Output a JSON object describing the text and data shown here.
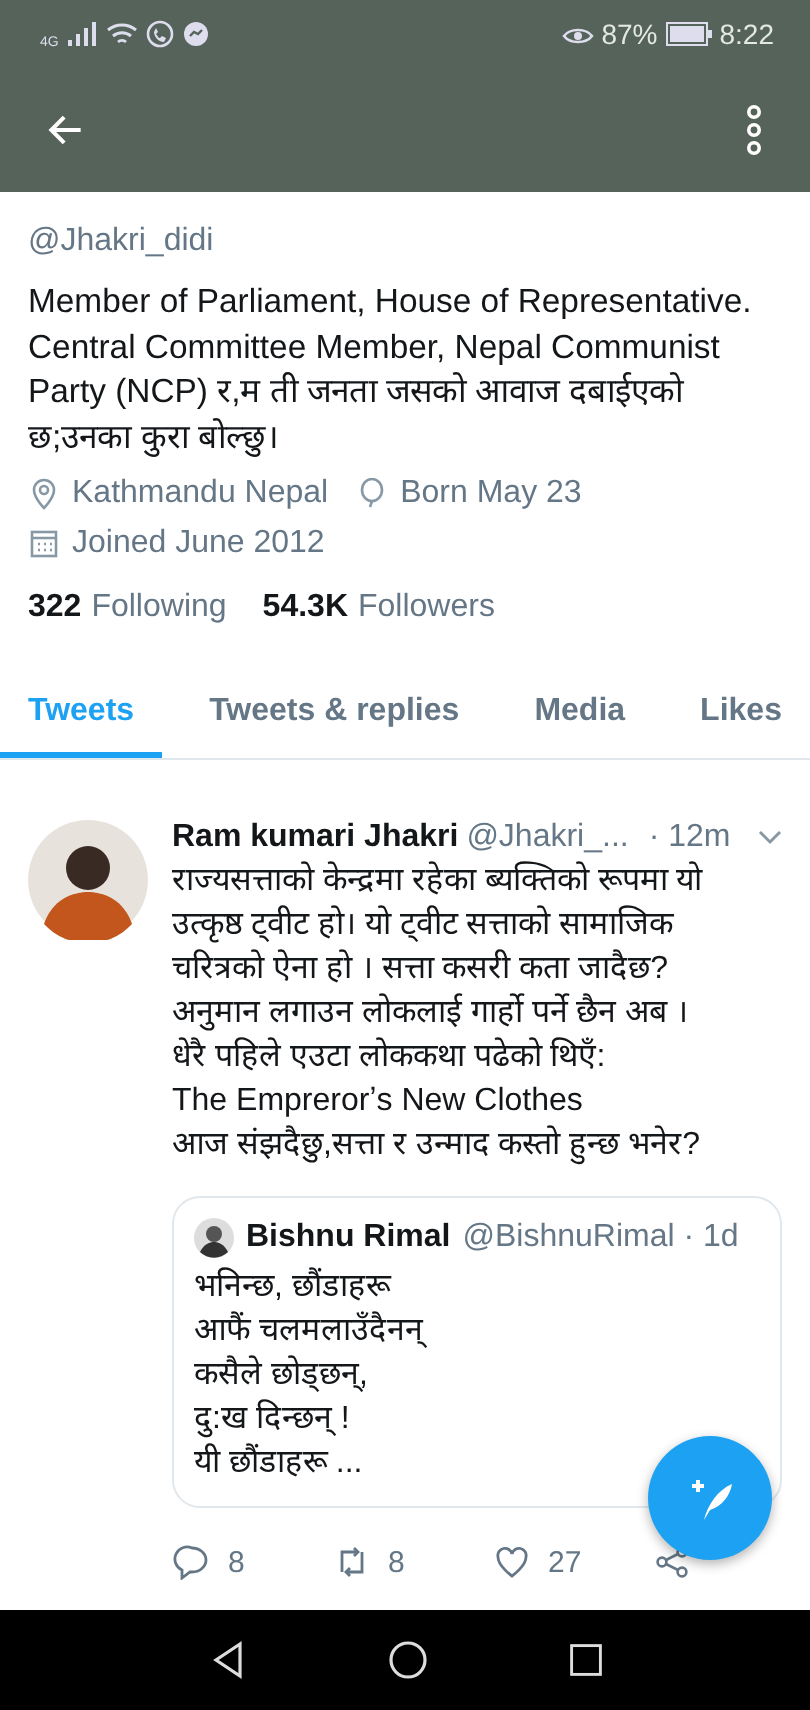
{
  "status_bar": {
    "network": "4G",
    "battery": "87%",
    "time": "8:22"
  },
  "profile": {
    "handle": "@Jhakri_didi",
    "bio": "Member of Parliament, House of Representative. Central Committee Member, Nepal Communist Party (NCP) र,म ती जनता जसको आवाज दबाईएको छ;उनका कुरा बोल्छु।",
    "meta": [
      {
        "kind": "location",
        "text": "Kathmandu Nepal"
      },
      {
        "kind": "birthday",
        "text": "Born May 23"
      },
      {
        "kind": "joined",
        "text": "Joined June 2012"
      }
    ],
    "stats": [
      {
        "count": "322",
        "label": "Following"
      },
      {
        "count": "54.3K",
        "label": "Followers"
      }
    ]
  },
  "tabs": [
    {
      "label": "Tweets",
      "selected": true
    },
    {
      "label": "Tweets & replies",
      "selected": false
    },
    {
      "label": "Media",
      "selected": false
    },
    {
      "label": "Likes",
      "selected": false
    }
  ],
  "tweet": {
    "author": "Ram kumari Jhakri",
    "handle": "@Jhakri_...",
    "time": "· 12m",
    "lines": [
      "राज्यसत्ताको केन्द्रमा रहेका ब्यक्तिको रूपमा यो",
      "उत्कृष्ठ ट्वीट हो। यो ट्वीट सत्ताको सामाजिक",
      "चरित्रको ऐना हो । सत्ता कसरी कता जादैछ?",
      "अनुमान लगाउन लोकलाई गार्हो पर्ने छैन अब ।",
      "धेरै पहिले एउटा लोककथा पढेको थिएँ:",
      "The Emprerorʼs New Clothes",
      "आज संझदैछु,सत्ता र उन्माद कस्तो हुन्छ भनेर?"
    ],
    "quote": {
      "author": "Bishnu Rimal",
      "handle": "@BishnuRimal · 1d",
      "lines": [
        "भनिन्छ, छौंडाहरू",
        "आफैं चलमलाउँदैनन्",
        "कसैले छोड्छन्,",
        "दु:ख दिन्छन् !",
        "यी छौंडाहरू ..."
      ]
    },
    "actions": [
      {
        "kind": "reply",
        "count": "8"
      },
      {
        "kind": "retweet",
        "count": "8"
      },
      {
        "kind": "like",
        "count": "27"
      },
      {
        "kind": "share"
      }
    ]
  }
}
